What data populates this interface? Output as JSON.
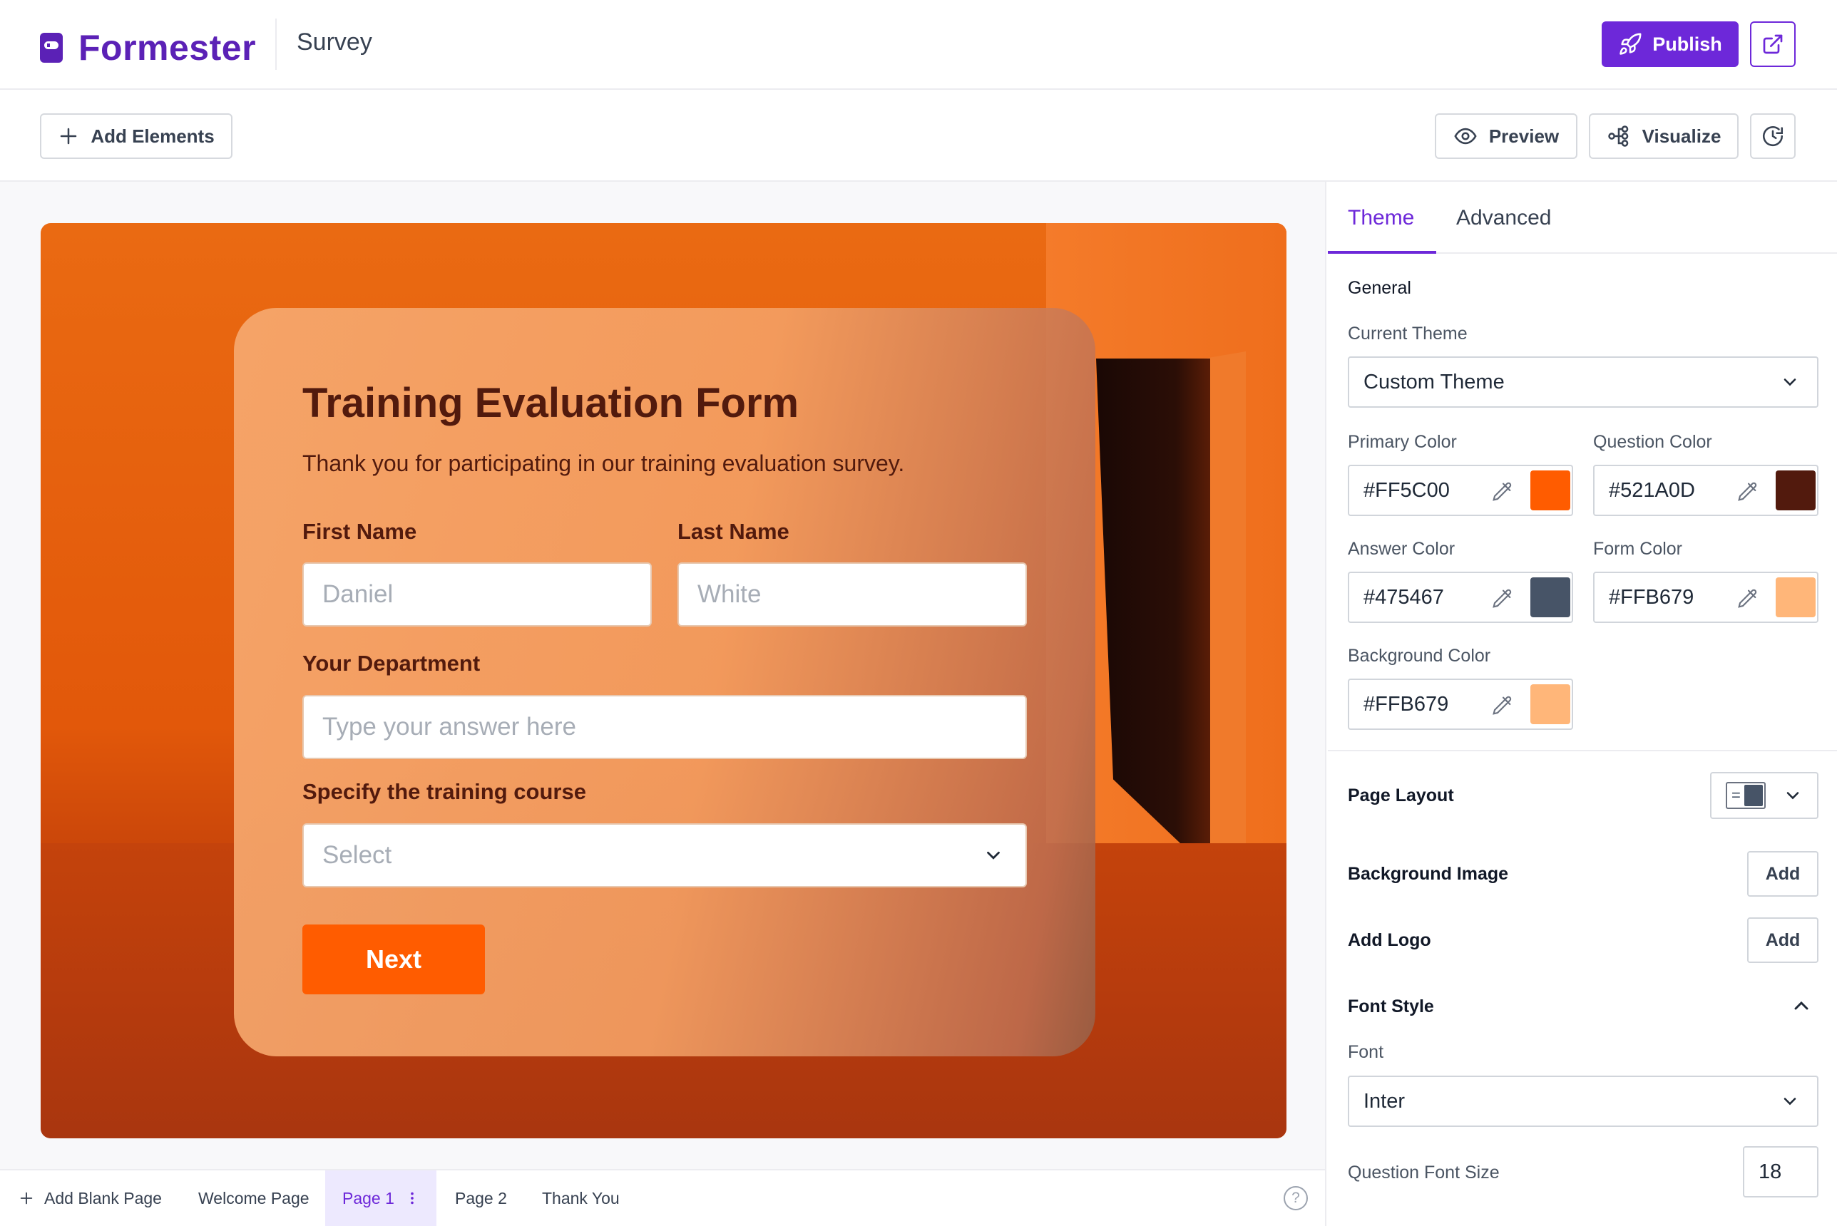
{
  "app": {
    "brand": "Formester",
    "doc_title": "Survey"
  },
  "header": {
    "publish_label": "Publish",
    "open_icon": "external-link-icon"
  },
  "toolbar": {
    "add_elements_label": "Add Elements",
    "preview_label": "Preview",
    "visualize_label": "Visualize",
    "history_icon": "history-icon"
  },
  "form": {
    "title": "Training Evaluation Form",
    "subtitle": "Thank you for participating in our training evaluation survey.",
    "first_name_label": "First Name",
    "first_name_placeholder": "Daniel",
    "last_name_label": "Last Name",
    "last_name_placeholder": "White",
    "department_label": "Your Department",
    "department_placeholder": "Type your answer here",
    "course_label": "Specify the training course",
    "course_placeholder": "Select",
    "next_label": "Next"
  },
  "pages": {
    "add_blank_label": "Add Blank Page",
    "tabs": [
      "Welcome Page",
      "Page 1",
      "Page 2",
      "Thank You"
    ],
    "active": "Page 1",
    "help_icon": "?"
  },
  "panel": {
    "tabs": [
      "Theme",
      "Advanced"
    ],
    "active_tab": "Theme",
    "general_title": "General",
    "current_theme_label": "Current Theme",
    "current_theme_value": "Custom Theme",
    "primary_color_label": "Primary Color",
    "primary_color": "#FF5C00",
    "question_color_label": "Question Color",
    "question_color": "#521A0D",
    "answer_color_label": "Answer Color",
    "answer_color": "#475467",
    "form_color_label": "Form Color",
    "form_color": "#FFB679",
    "background_color_label": "Background Color",
    "background_color": "#FFB679",
    "page_layout_label": "Page Layout",
    "background_image_label": "Background Image",
    "add_logo_label": "Add Logo",
    "add_label": "Add",
    "font_style_label": "Font Style",
    "font_label": "Font",
    "font_value": "Inter",
    "question_font_size_label": "Question Font Size",
    "question_font_size": "18"
  },
  "colors": {
    "accent": "#6d28d9",
    "brand": "#5b21b6",
    "button": "#ff5c00"
  }
}
